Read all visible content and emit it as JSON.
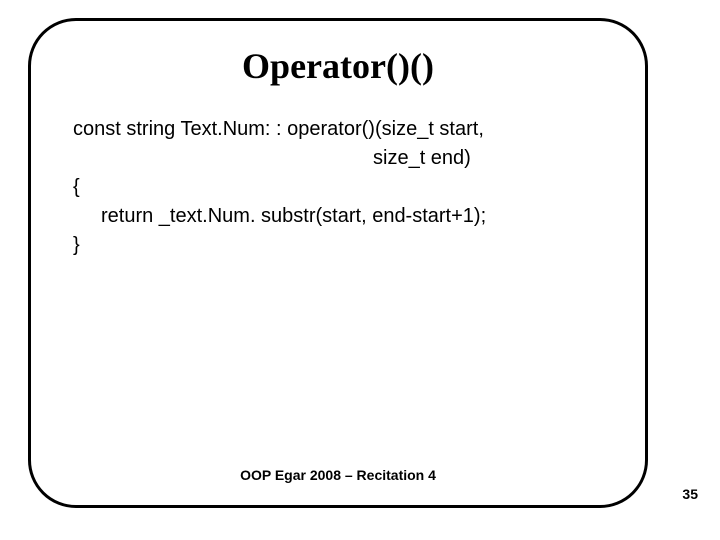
{
  "title": "Operator()()",
  "code": {
    "line1": "const string Text.Num: : operator()(size_t start,",
    "line2": "size_t end)",
    "line3": "{",
    "line4": "return _text.Num. substr(start, end-start+1);",
    "line5": "}"
  },
  "footer": "OOP Egar 2008 – Recitation 4",
  "page_number": "35"
}
